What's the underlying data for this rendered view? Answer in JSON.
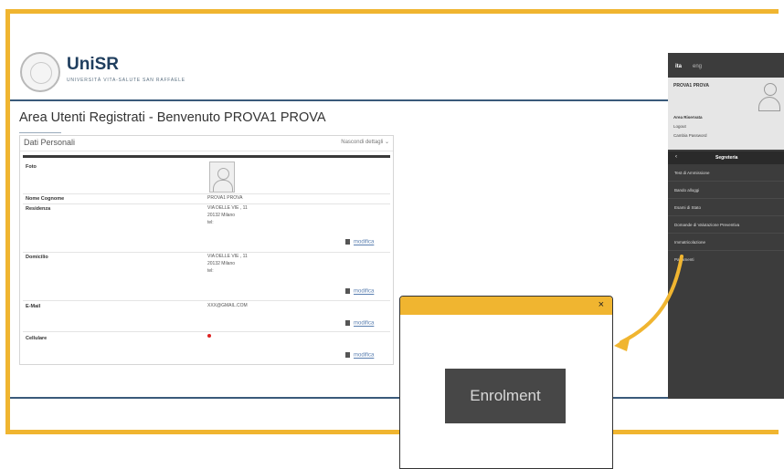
{
  "header": {
    "logo_name": "UniSR",
    "logo_subtitle": "UNIVERSITÀ VITA-SALUTE SAN RAFFAELE"
  },
  "page": {
    "title": "Area Utenti Registrati - Benvenuto PROVA1 PROVA"
  },
  "panel": {
    "title": "Dati Personali",
    "toggle_label": "Nascondi dettagli",
    "edit_label": "modifica",
    "rows": {
      "foto": {
        "label": "Foto"
      },
      "nome": {
        "label": "Nome Cognome",
        "value": "PROVA1 PROVA"
      },
      "residenza": {
        "label": "Residenza",
        "value": "VIA DELLE VIE , 11\n20132 Milano\ntel:"
      },
      "domicilio": {
        "label": "Domicilio",
        "value": "VIA DELLE VIE , 11\n20132 Milano\ntel:"
      },
      "email": {
        "label": "E-Mail",
        "value": "XXX@GMAIL.COM"
      },
      "cellulare": {
        "label": "Cellulare"
      }
    }
  },
  "sidebar": {
    "lang_it": "ita",
    "lang_en": "eng",
    "user_name": "PROVA1 PROVA",
    "area_riservata": "Area Riservata",
    "logout": "Logout",
    "cambia_password": "Cambia Password",
    "back_icon": "chevron-left-icon",
    "section_title": "Segreteria",
    "items": [
      "Test di Ammissione",
      "Bando alloggi",
      "Esami di Stato",
      "Domande di Valutazione Preventiva",
      "Immatricolazione",
      "Pagamenti"
    ]
  },
  "popup": {
    "close_label": "×",
    "button_label": "Enrolment"
  },
  "colors": {
    "accent": "#f0b530",
    "sidebar": "#3c3c3c",
    "header_line": "#3a5a7a"
  }
}
